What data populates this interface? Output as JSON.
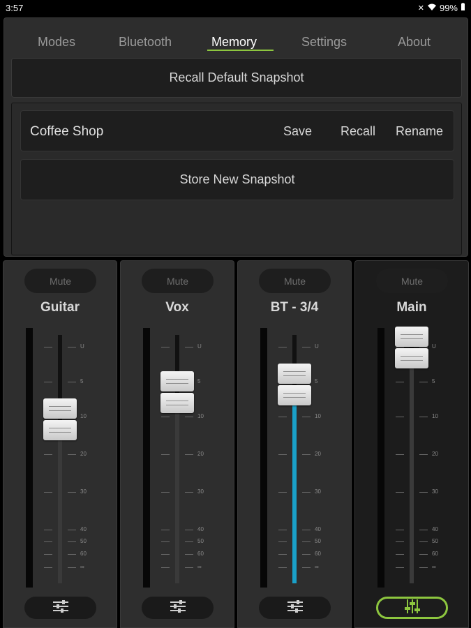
{
  "status_bar": {
    "time": "3:57",
    "battery": "99%"
  },
  "tabs": [
    {
      "label": "Modes",
      "active": false
    },
    {
      "label": "Bluetooth",
      "active": false
    },
    {
      "label": "Memory",
      "active": true
    },
    {
      "label": "Settings",
      "active": false
    },
    {
      "label": "About",
      "active": false
    }
  ],
  "memory": {
    "recall_default_label": "Recall Default Snapshot",
    "snapshots": [
      {
        "name": "Coffee Shop",
        "save_label": "Save",
        "recall_label": "Recall",
        "rename_label": "Rename"
      }
    ],
    "store_new_label": "Store New Snapshot"
  },
  "scale_labels": [
    "U",
    "5",
    "10",
    "20",
    "30",
    "40",
    "50",
    "60",
    "∞"
  ],
  "channels": [
    {
      "name": "Guitar",
      "mute_label": "Mute",
      "fader_level": 0.29,
      "active_color": "#3a3a3a",
      "settings_icon": "sliders-icon"
    },
    {
      "name": "Vox",
      "mute_label": "Mute",
      "fader_level": 0.18,
      "active_color": "#3a3a3a",
      "settings_icon": "sliders-icon"
    },
    {
      "name": "BT - 3/4",
      "mute_label": "Mute",
      "fader_level": 0.15,
      "active_color": "#1aa0c8",
      "settings_icon": "sliders-icon"
    },
    {
      "name": "Main",
      "mute_label": "Mute",
      "fader_level": 0.0,
      "active_color": "#3a3a3a",
      "settings_icon": "mixer-sliders-icon"
    }
  ],
  "accent_color": "#8dc63f"
}
